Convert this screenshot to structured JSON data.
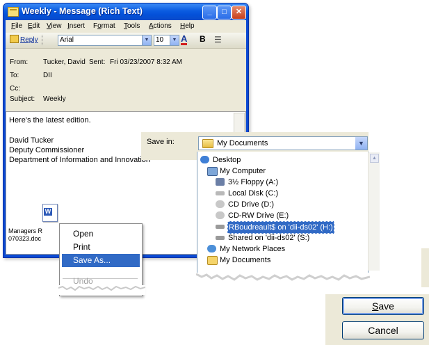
{
  "message_window": {
    "title": "Weekly - Message (Rich Text)",
    "title_buttons": {
      "minimize": "_",
      "maximize": "□",
      "close": "✕"
    },
    "menu": [
      {
        "label": "File",
        "key": "F",
        "rest": "ile"
      },
      {
        "label": "Edit",
        "key": "E",
        "rest": "dit"
      },
      {
        "label": "View",
        "key": "V",
        "rest": "iew"
      },
      {
        "label": "Insert",
        "key": "I",
        "rest": "nsert"
      },
      {
        "label": "Format",
        "key": "o",
        "pre": "F",
        "rest": "rmat"
      },
      {
        "label": "Tools",
        "key": "T",
        "rest": "ools"
      },
      {
        "label": "Actions",
        "key": "A",
        "rest": "ctions"
      },
      {
        "label": "Help",
        "key": "H",
        "rest": "elp"
      }
    ],
    "toolbar": {
      "reply": "Reply",
      "font": "Arial",
      "size": "10",
      "font_color_glyph": "A",
      "bold_glyph": "B",
      "list_glyph": "☰"
    },
    "headers": {
      "from_label": "From:",
      "from_value": "Tucker, David",
      "sent_label": "Sent:",
      "sent_value": "Fri 03/23/2007 8:32 AM",
      "to_label": "To:",
      "to_value": "DII",
      "cc_label": "Cc:",
      "subject_label": "Subject:",
      "subject_value": "Weekly"
    },
    "body": {
      "line1": "Here's the latest edition.",
      "sig1": "David Tucker",
      "sig2": "Deputy Commissioner",
      "sig3": "Department of Information and Innovation"
    },
    "attachment": {
      "line1": "Managers R",
      "line2": "070323.doc"
    }
  },
  "context_menu": {
    "items": [
      "Open",
      "Print",
      "Save As...",
      "Undo"
    ],
    "selected_index": 2
  },
  "save_dialog": {
    "save_in_label": "Save in:",
    "save_in_value": "My Documents",
    "tree": [
      {
        "label": "Desktop",
        "icon": "desktop-icon"
      },
      {
        "label": "My Computer",
        "icon": "computer-icon"
      },
      {
        "label": "3½ Floppy (A:)",
        "icon": "floppy-icon"
      },
      {
        "label": "Local Disk (C:)",
        "icon": "disk-icon"
      },
      {
        "label": "CD Drive (D:)",
        "icon": "cd-icon"
      },
      {
        "label": "CD-RW Drive (E:)",
        "icon": "cd-icon"
      },
      {
        "label": "RBoudreault$ on 'dii-ds02' (H:)",
        "icon": "network-drive-icon",
        "selected": true
      },
      {
        "label": "Shared on 'dii-ds02' (S:)",
        "icon": "network-drive-icon"
      },
      {
        "label": "My Network Places",
        "icon": "network-places-icon"
      },
      {
        "label": "My Documents",
        "icon": "folder-icon"
      }
    ],
    "save_button": {
      "label": "Save",
      "key": "S",
      "rest": "ave"
    },
    "cancel_button": "Cancel"
  },
  "colors": {
    "xp_title_blue": "#0a5be0",
    "selection_blue": "#316ac5",
    "dialog_face": "#ece9d8"
  }
}
